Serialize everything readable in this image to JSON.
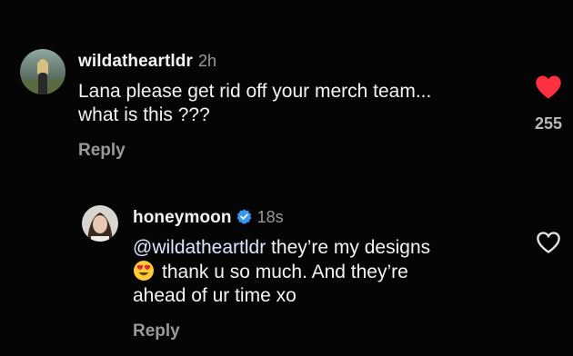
{
  "comments": [
    {
      "username": "wildatheartldr",
      "time": "2h",
      "text_line1": "Lana please get rid off your merch team...",
      "text_line2": "what is this ???",
      "reply_label": "Reply",
      "liked": true,
      "like_count": "255",
      "heart_color": "#ff3040"
    },
    {
      "username": "honeymoon",
      "time": "18s",
      "verified": true,
      "mention": "@wildatheartldr",
      "text_line1_rest": " they’re my designs",
      "text_line2": "thank u so much. And they’re",
      "text_line3": "ahead of ur time xo",
      "reply_label": "Reply",
      "liked": false,
      "verified_color": "#3897f0"
    }
  ]
}
